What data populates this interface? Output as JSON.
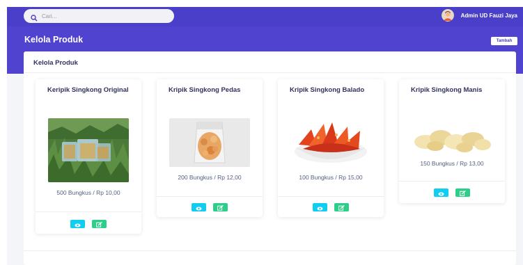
{
  "search": {
    "placeholder": "Cari..."
  },
  "user": {
    "name": "Admin UD Fauzi Jaya"
  },
  "header": {
    "title": "Kelola Produk",
    "add_label": "Tambah"
  },
  "panel": {
    "title": "Kelola Produk"
  },
  "products": [
    {
      "name": "Keripik Singkong Original",
      "quantity_price": "500 Bungkus / Rp 10,00"
    },
    {
      "name": "Kripik Singkong Pedas",
      "quantity_price": "200 Bungkus / Rp 12,00"
    },
    {
      "name": "Kripik Singkong Balado",
      "quantity_price": "100 Bungkus / Rp 15,00"
    },
    {
      "name": "Kripik Singkong Manis",
      "quantity_price": "150 Bungkus / Rp 13,00"
    }
  ],
  "icons": {
    "view": "eye-icon",
    "edit": "edit-icon",
    "search": "search-icon"
  },
  "colors": {
    "primary": "#4f43cf",
    "info": "#11cdef",
    "success": "#2dce89"
  }
}
